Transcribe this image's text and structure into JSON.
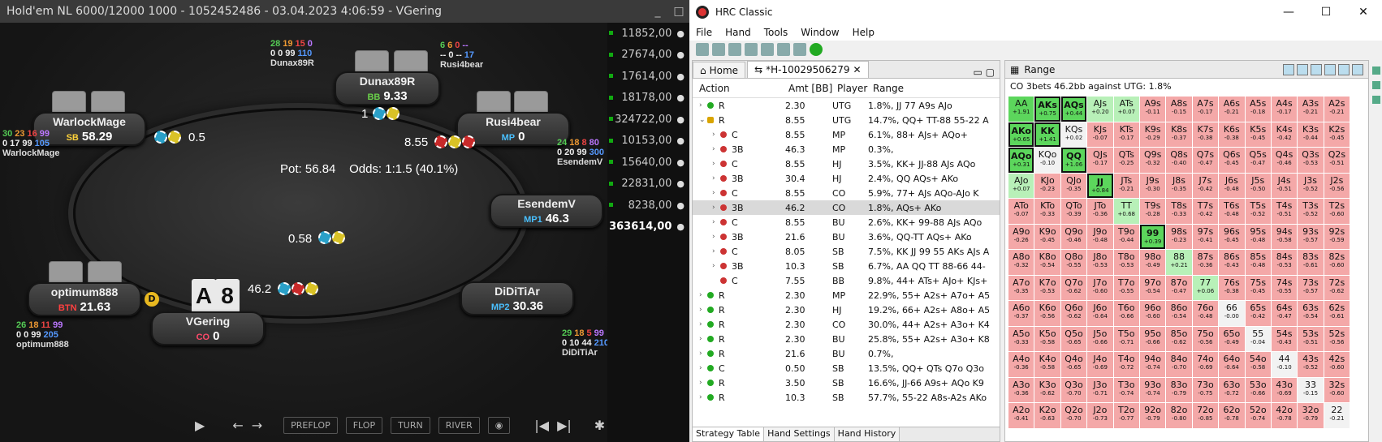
{
  "poker": {
    "title": "Hold'em NL 6000/12000 1000 - 1052452486 - 03.04.2023 4:06:59 - VGering",
    "window_controls": [
      "_",
      "□"
    ],
    "pot_text": "Pot:  56.84",
    "odds_text": "Odds:  1:1.5 (40.1%)",
    "seats": [
      {
        "name": "Dunax89R",
        "pos": "BB",
        "pos_color": "#6ad04a",
        "stack": "9.33",
        "bet": "1",
        "stat1": [
          [
            "28",
            "#5c5"
          ],
          [
            "19",
            "#e93"
          ],
          [
            "15",
            "#e44"
          ],
          [
            "0",
            "#b7f"
          ]
        ],
        "stat2": [
          "0",
          "0",
          "99",
          "110"
        ],
        "label": "Dunax89R"
      },
      {
        "name": "Rusi4bear",
        "pos": "MP",
        "pos_color": "#4ac0ff",
        "stack": "0",
        "bet": "8.55",
        "stat1": [
          [
            "6",
            "#5c5"
          ],
          [
            "6",
            "#e93"
          ],
          [
            "0",
            "#e44"
          ],
          [
            "--",
            "#b7f"
          ]
        ],
        "stat2": [
          "--",
          "0",
          "--",
          "17"
        ],
        "label": "Rusi4bear"
      },
      {
        "name": "WarlockMage",
        "pos": "SB",
        "pos_color": "#ffd23a",
        "stack": "58.29",
        "bet": "0.5",
        "stat1": [
          [
            "30",
            "#5c5"
          ],
          [
            "23",
            "#e93"
          ],
          [
            "16",
            "#e44"
          ],
          [
            "99",
            "#b7f"
          ]
        ],
        "stat2": [
          "0",
          "17",
          "99",
          "105"
        ],
        "label": "WarlockMage"
      },
      {
        "name": "EsendemV",
        "pos": "MP1",
        "pos_color": "#4ac0ff",
        "stack": "46.3",
        "bet": "",
        "stat1": [
          [
            "24",
            "#5c5"
          ],
          [
            "18",
            "#e93"
          ],
          [
            "8",
            "#e44"
          ],
          [
            "80",
            "#b7f"
          ]
        ],
        "stat2": [
          "0",
          "20",
          "99",
          "300"
        ],
        "label": "EsendemV"
      },
      {
        "name": "optimum888",
        "pos": "BTN",
        "pos_color": "#ff4040",
        "stack": "21.63",
        "bet": "0.58",
        "stat1": [
          [
            "26",
            "#5c5"
          ],
          [
            "18",
            "#e93"
          ],
          [
            "11",
            "#e44"
          ],
          [
            "99",
            "#b7f"
          ]
        ],
        "stat2": [
          "0",
          "0",
          "99",
          "205"
        ],
        "label": "optimum888"
      },
      {
        "name": "VGering",
        "pos": "CO",
        "pos_color": "#ff4a6a",
        "stack": "0",
        "bet": "46.2",
        "cards": [
          "A",
          "8"
        ]
      },
      {
        "name": "DiDiTiAr",
        "pos": "MP2",
        "pos_color": "#4ac0ff",
        "stack": "30.36",
        "bet": "",
        "stat1": [
          [
            "29",
            "#5c5"
          ],
          [
            "18",
            "#e93"
          ],
          [
            "5",
            "#e44"
          ],
          [
            "99",
            "#b7f"
          ]
        ],
        "stat2": [
          "0",
          "10",
          "44",
          "210"
        ],
        "label": "DiDiTiAr"
      }
    ],
    "stacks": [
      {
        "v": "11852,00",
        "sel": false
      },
      {
        "v": "27674,00",
        "sel": false
      },
      {
        "v": "17614,00",
        "sel": false
      },
      {
        "v": "18178,00",
        "sel": false
      },
      {
        "v": "324722,00",
        "sel": false
      },
      {
        "v": "10153,00",
        "sel": false
      },
      {
        "v": "15640,00",
        "sel": false
      },
      {
        "v": "22831,00",
        "sel": false
      },
      {
        "v": "8238,00",
        "sel": false
      },
      {
        "v": "363614,00",
        "sel": true
      }
    ],
    "controls": [
      "PREFLOP",
      "FLOP",
      "TURN",
      "RIVER"
    ],
    "dealer": "D"
  },
  "hrc": {
    "title": "HRC Classic",
    "window_controls": [
      "—",
      "☐",
      "✕"
    ],
    "menu": [
      "File",
      "Hand",
      "Tools",
      "Window",
      "Help"
    ],
    "tabs": [
      {
        "label": "Home"
      },
      {
        "label": "*H-10029506279"
      }
    ],
    "columns": [
      "Action",
      "Amt [BB]",
      "Player",
      "Range"
    ],
    "rows": [
      {
        "exp": "›",
        "ind": 0,
        "dot": "g",
        "act": "R",
        "amt": "2.30",
        "pl": "UTG",
        "rg": "1.8%, JJ 77 A9s AJo"
      },
      {
        "exp": "⌄",
        "ind": 0,
        "dot": "y",
        "act": "R",
        "amt": "8.55",
        "pl": "UTG",
        "rg": "14.7%, QQ+ TT-88 55-22 A"
      },
      {
        "exp": "›",
        "ind": 1,
        "dot": "r",
        "act": "C",
        "amt": "8.55",
        "pl": "MP",
        "rg": "6.1%, 88+ AJs+ AQo+"
      },
      {
        "exp": "›",
        "ind": 1,
        "dot": "r",
        "act": "3B",
        "amt": "46.3",
        "pl": "MP",
        "rg": "0.3%,"
      },
      {
        "exp": "›",
        "ind": 1,
        "dot": "r",
        "act": "C",
        "amt": "8.55",
        "pl": "HJ",
        "rg": "3.5%, KK+ JJ-88 AJs AQo"
      },
      {
        "exp": "›",
        "ind": 1,
        "dot": "r",
        "act": "3B",
        "amt": "30.4",
        "pl": "HJ",
        "rg": "2.4%, QQ AQs+ AKo"
      },
      {
        "exp": "›",
        "ind": 1,
        "dot": "r",
        "act": "C",
        "amt": "8.55",
        "pl": "CO",
        "rg": "5.9%, 77+ AJs AQo-AJo K"
      },
      {
        "exp": "›",
        "ind": 1,
        "dot": "r",
        "act": "3B",
        "amt": "46.2",
        "pl": "CO",
        "rg": "1.8%, AQs+ AKo",
        "hl": true
      },
      {
        "exp": "›",
        "ind": 1,
        "dot": "r",
        "act": "C",
        "amt": "8.55",
        "pl": "BU",
        "rg": "2.6%, KK+ 99-88 AJs AQo"
      },
      {
        "exp": "›",
        "ind": 1,
        "dot": "r",
        "act": "3B",
        "amt": "21.6",
        "pl": "BU",
        "rg": "3.6%, QQ-TT AQs+ AKo"
      },
      {
        "exp": "›",
        "ind": 1,
        "dot": "r",
        "act": "C",
        "amt": "8.05",
        "pl": "SB",
        "rg": "7.5%, KK JJ 99 55 AKs AJs A"
      },
      {
        "exp": "›",
        "ind": 1,
        "dot": "r",
        "act": "3B",
        "amt": "10.3",
        "pl": "SB",
        "rg": "6.7%, AA QQ TT 88-66 44-"
      },
      {
        "exp": "",
        "ind": 1,
        "dot": "r",
        "act": "C",
        "amt": "7.55",
        "pl": "BB",
        "rg": "9.8%, 44+ ATs+ AJo+ KJs+"
      },
      {
        "exp": "›",
        "ind": 0,
        "dot": "g",
        "act": "R",
        "amt": "2.30",
        "pl": "MP",
        "rg": "22.9%, 55+ A2s+ A7o+ A5"
      },
      {
        "exp": "›",
        "ind": 0,
        "dot": "g",
        "act": "R",
        "amt": "2.30",
        "pl": "HJ",
        "rg": "19.2%, 66+ A2s+ A8o+ A5"
      },
      {
        "exp": "›",
        "ind": 0,
        "dot": "g",
        "act": "R",
        "amt": "2.30",
        "pl": "CO",
        "rg": "30.0%, 44+ A2s+ A3o+ K4"
      },
      {
        "exp": "›",
        "ind": 0,
        "dot": "g",
        "act": "R",
        "amt": "2.30",
        "pl": "BU",
        "rg": "25.8%, 55+ A2s+ A3o+ K8"
      },
      {
        "exp": "›",
        "ind": 0,
        "dot": "g",
        "act": "R",
        "amt": "21.6",
        "pl": "BU",
        "rg": "0.7%,"
      },
      {
        "exp": "›",
        "ind": 0,
        "dot": "g",
        "act": "C",
        "amt": "0.50",
        "pl": "SB",
        "rg": "13.5%, QQ+ QTs Q7o Q3o"
      },
      {
        "exp": "›",
        "ind": 0,
        "dot": "g",
        "act": "R",
        "amt": "3.50",
        "pl": "SB",
        "rg": "16.6%, JJ-66 A9s+ AQo K9"
      },
      {
        "exp": "›",
        "ind": 0,
        "dot": "g",
        "act": "R",
        "amt": "10.3",
        "pl": "SB",
        "rg": "57.7%, 55-22 A8s-A2s AKo"
      }
    ],
    "bottom_tabs": [
      "Strategy Table",
      "Hand Settings",
      "Hand History"
    ],
    "range_tab": "Range",
    "range_caption": "CO 3bets 46.2bb against UTG: 1.8%",
    "grid": [
      [
        "AA|+1.91|ft",
        "AKs|+0.75|s",
        "AQs|+0.44|s",
        "AJs|+0.20|g",
        "ATs|+0.07|g",
        "A9s|-0.11|r",
        "A8s|-0.15|r",
        "A7s|-0.17|r",
        "A6s|-0.21|r",
        "A5s|-0.18|r",
        "A4s|-0.17|r",
        "A3s|-0.21|r",
        "A2s|-0.21|r"
      ],
      [
        "AKo|+0.65|s",
        "KK|+1.41|s",
        "KQs|+0.02|w",
        "KJs|-0.07|r",
        "KTs|-0.17|r",
        "K9s|-0.29|r",
        "K8s|-0.37|r",
        "K7s|-0.38|r",
        "K6s|-0.38|r",
        "K5s|-0.45|r",
        "K4s|-0.42|r",
        "K3s|-0.44|r",
        "K2s|-0.45|r"
      ],
      [
        "AQo|+0.31|s",
        "KQo|-0.10|w",
        "QQ|+1.06|s",
        "QJs|-0.17|r",
        "QTs|-0.25|r",
        "Q9s|-0.32|r",
        "Q8s|-0.40|r",
        "Q7s|-0.47|r",
        "Q6s|-0.45|r",
        "Q5s|-0.47|r",
        "Q4s|-0.46|r",
        "Q3s|-0.53|r",
        "Q2s|-0.51|r"
      ],
      [
        "AJo|+0.07|g",
        "KJo|-0.23|r",
        "QJo|-0.35|r",
        "JJ|+0.84|s",
        "JTs|-0.21|r",
        "J9s|-0.30|r",
        "J8s|-0.35|r",
        "J7s|-0.42|r",
        "J6s|-0.48|r",
        "J5s|-0.50|r",
        "J4s|-0.51|r",
        "J3s|-0.52|r",
        "J2s|-0.56|r"
      ],
      [
        "ATo|-0.07|r",
        "KTo|-0.33|r",
        "QTo|-0.39|r",
        "JTo|-0.36|r",
        "TT|+0.68|g",
        "T9s|-0.28|r",
        "T8s|-0.33|r",
        "T7s|-0.42|r",
        "T6s|-0.48|r",
        "T5s|-0.52|r",
        "T4s|-0.51|r",
        "T3s|-0.52|r",
        "T2s|-0.60|r"
      ],
      [
        "A9o|-0.26|r",
        "K9o|-0.45|r",
        "Q9o|-0.46|r",
        "J9o|-0.48|r",
        "T9o|-0.44|r",
        "99|+0.39|s",
        "98s|-0.23|r",
        "97s|-0.41|r",
        "96s|-0.45|r",
        "95s|-0.48|r",
        "94s|-0.58|r",
        "93s|-0.57|r",
        "92s|-0.59|r"
      ],
      [
        "A8o|-0.32|r",
        "K8o|-0.54|r",
        "Q8o|-0.55|r",
        "J8o|-0.53|r",
        "T8o|-0.53|r",
        "98o|-0.49|r",
        "88|+0.21|g",
        "87s|-0.36|r",
        "86s|-0.43|r",
        "85s|-0.48|r",
        "84s|-0.53|r",
        "83s|-0.61|r",
        "82s|-0.60|r"
      ],
      [
        "A7o|-0.35|r",
        "K7o|-0.53|r",
        "Q7o|-0.62|r",
        "J7o|-0.60|r",
        "T7o|-0.55|r",
        "97o|-0.54|r",
        "87o|-0.47|r",
        "77|+0.06|g",
        "76s|-0.38|r",
        "75s|-0.45|r",
        "74s|-0.55|r",
        "73s|-0.57|r",
        "72s|-0.62|r"
      ],
      [
        "A6o|-0.37|r",
        "K6o|-0.56|r",
        "Q6o|-0.62|r",
        "J6o|-0.64|r",
        "T6o|-0.66|r",
        "96o|-0.60|r",
        "86o|-0.54|r",
        "76o|-0.48|r",
        "66|-0.00|w",
        "65s|-0.42|r",
        "64s|-0.47|r",
        "63s|-0.54|r",
        "62s|-0.61|r"
      ],
      [
        "A5o|-0.33|r",
        "K5o|-0.58|r",
        "Q5o|-0.65|r",
        "J5o|-0.66|r",
        "T5o|-0.71|r",
        "95o|-0.66|r",
        "85o|-0.62|r",
        "75o|-0.56|r",
        "65o|-0.49|r",
        "55|-0.04|w",
        "54s|-0.43|r",
        "53s|-0.51|r",
        "52s|-0.56|r"
      ],
      [
        "A4o|-0.36|r",
        "K4o|-0.58|r",
        "Q4o|-0.65|r",
        "J4o|-0.69|r",
        "T4o|-0.72|r",
        "94o|-0.74|r",
        "84o|-0.70|r",
        "74o|-0.69|r",
        "64o|-0.64|r",
        "54o|-0.58|r",
        "44|-0.10|w",
        "43s|-0.52|r",
        "42s|-0.60|r"
      ],
      [
        "A3o|-0.36|r",
        "K3o|-0.62|r",
        "Q3o|-0.70|r",
        "J3o|-0.71|r",
        "T3o|-0.74|r",
        "93o|-0.74|r",
        "83o|-0.79|r",
        "73o|-0.75|r",
        "63o|-0.72|r",
        "53o|-0.66|r",
        "43o|-0.69|r",
        "33|-0.15|w",
        "32s|-0.60|r"
      ],
      [
        "A2o|-0.41|r",
        "K2o|-0.63|r",
        "Q2o|-0.70|r",
        "J2o|-0.73|r",
        "T2o|-0.77|r",
        "92o|-0.79|r",
        "82o|-0.80|r",
        "72o|-0.85|r",
        "62o|-0.78|r",
        "52o|-0.74|r",
        "42o|-0.78|r",
        "32o|-0.79|r",
        "22|-0.21|w"
      ]
    ],
    "colors": {
      "green_strong": "#5cd65c",
      "green_light": "#b8f0b8",
      "red_light": "#f4a8a8",
      "white": "#f2f2f2"
    }
  }
}
